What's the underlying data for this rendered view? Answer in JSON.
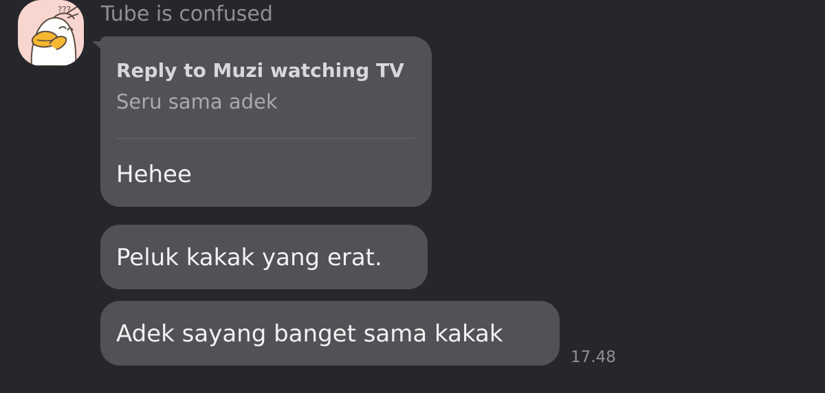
{
  "chat": {
    "sender": {
      "name": "Tube is confused",
      "avatar_icon": "confused-duck-avatar"
    },
    "messages": [
      {
        "reply_to_title": "Reply to Muzi watching TV",
        "reply_to_quote": "Seru sama adek",
        "text": "Hehee"
      },
      {
        "text": "Peluk kakak yang erat."
      },
      {
        "text": "Adek sayang banget sama kakak",
        "time": "17.48"
      }
    ]
  },
  "colors": {
    "background": "#26272b",
    "bubble": "#505256",
    "text_primary": "#f2f2f3",
    "text_secondary": "#8f9095",
    "avatar_background": "#f8d6cf"
  }
}
